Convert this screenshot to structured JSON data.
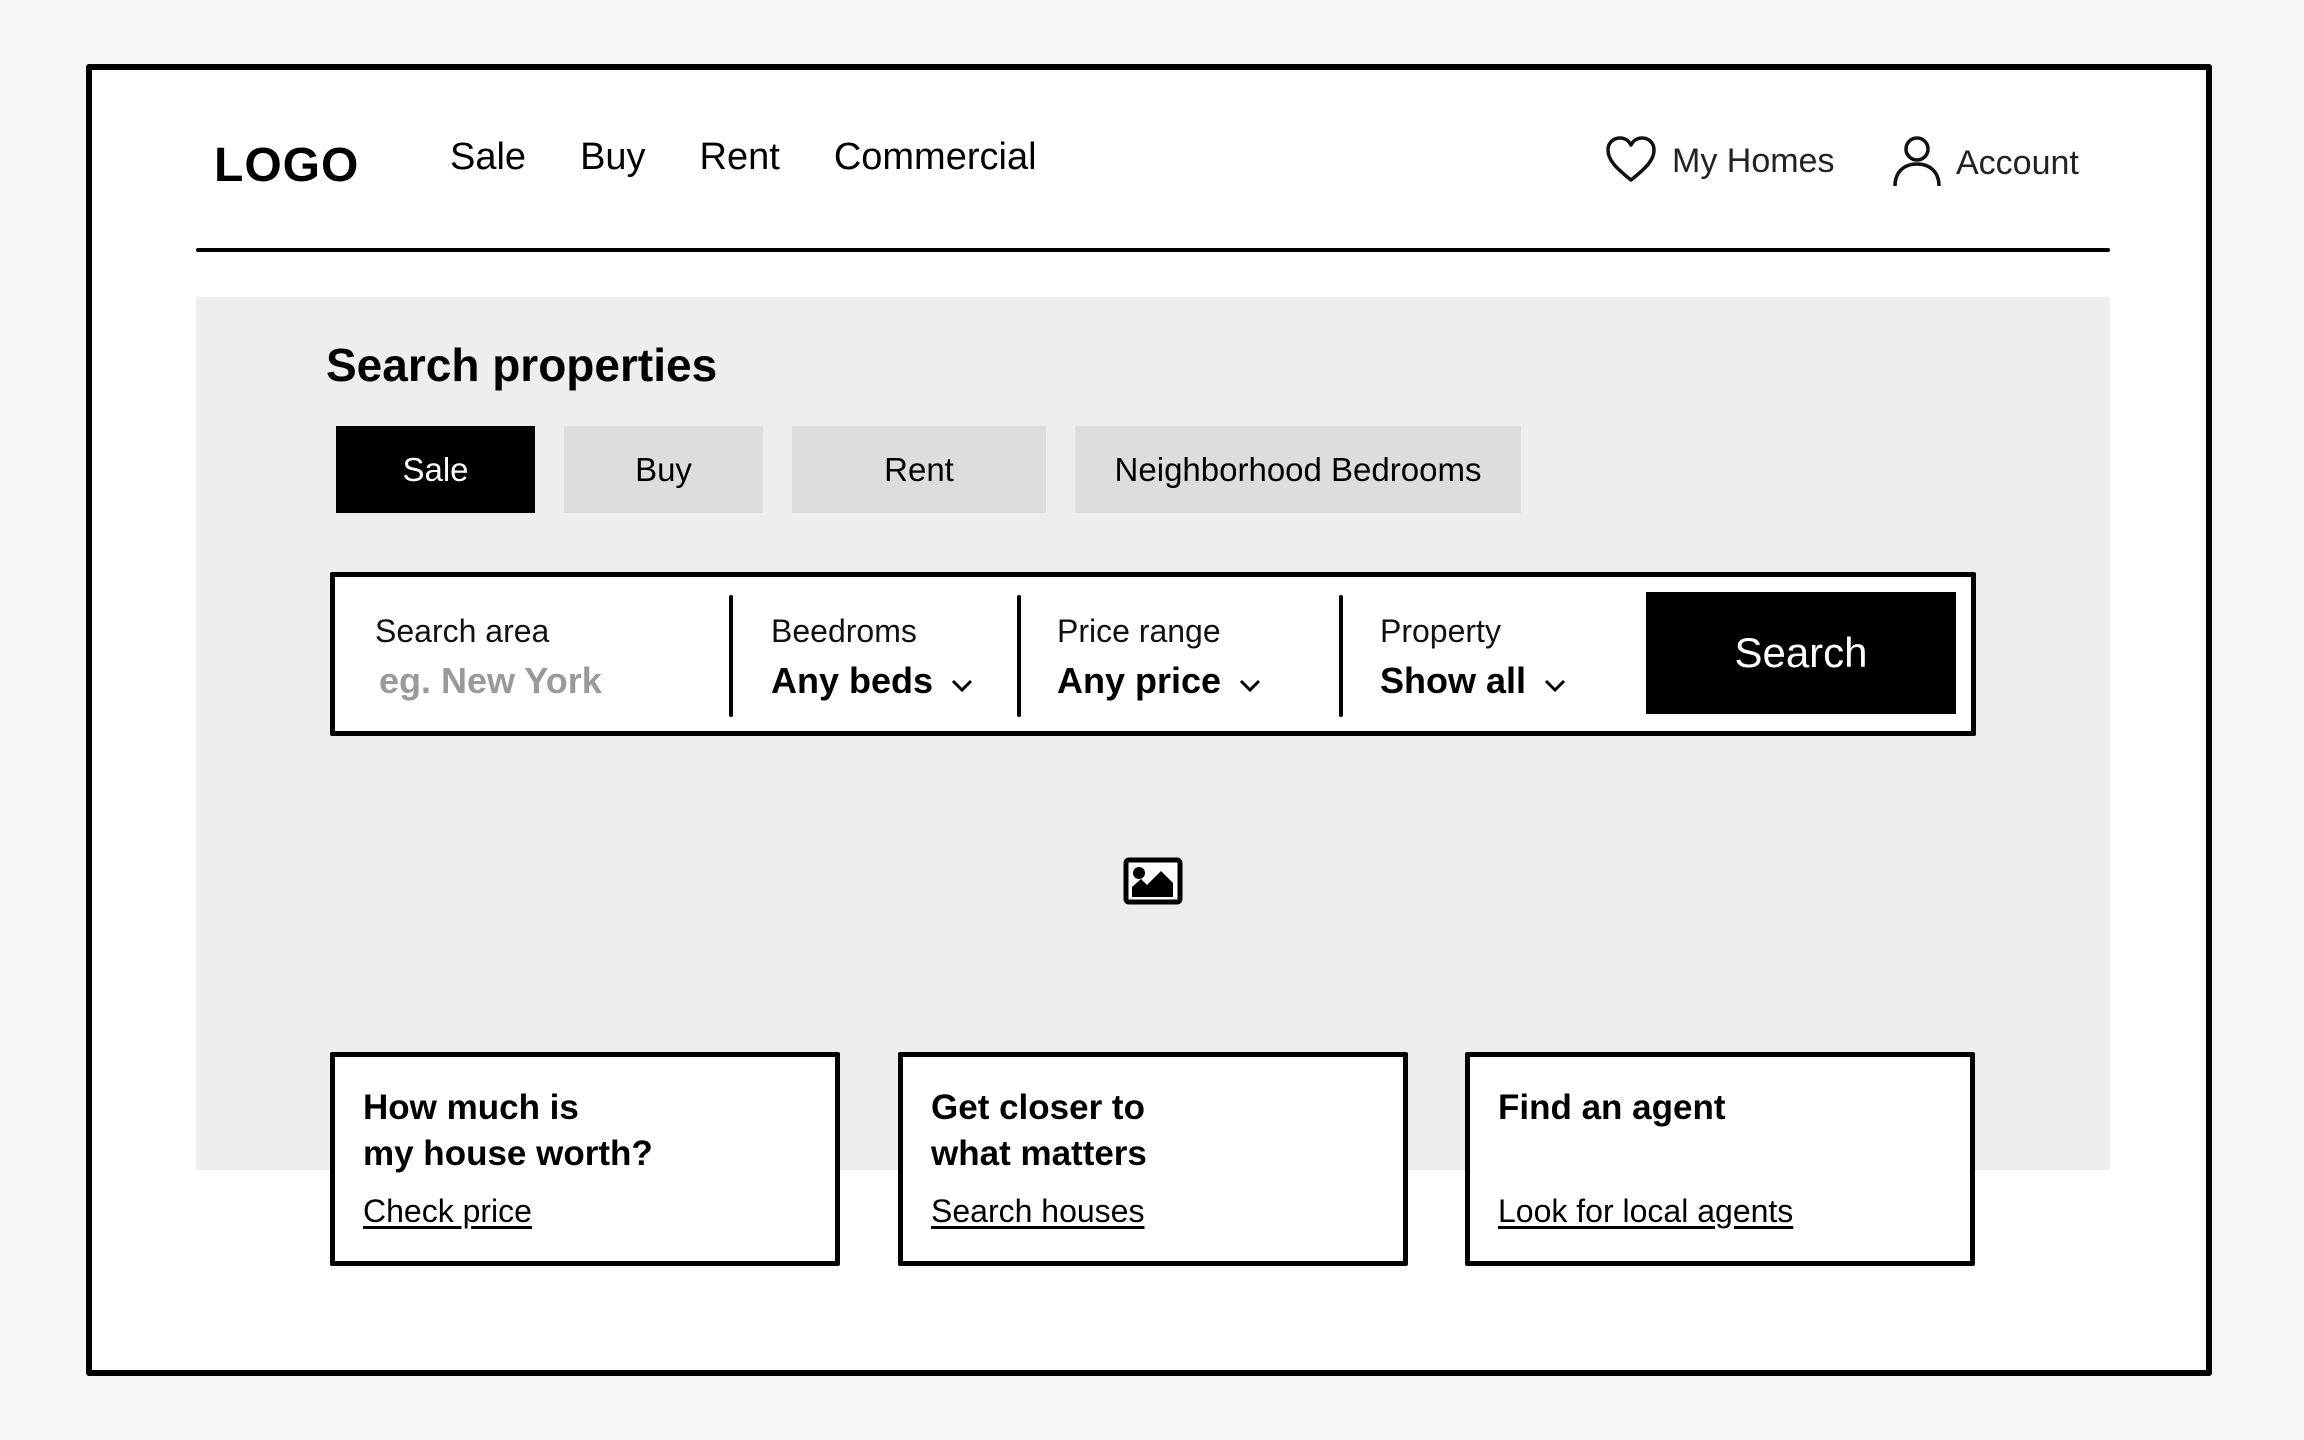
{
  "header": {
    "logo": "LOGO",
    "nav": [
      {
        "label": "Sale"
      },
      {
        "label": "Buy"
      },
      {
        "label": "Rent"
      },
      {
        "label": "Commercial"
      }
    ],
    "my_homes": {
      "label": "My Homes",
      "icon": "heart-icon"
    },
    "account": {
      "label": "Account",
      "icon": "user-icon"
    }
  },
  "hero": {
    "title": "Search properties",
    "tabs": [
      {
        "label": "Sale",
        "active": true
      },
      {
        "label": "Buy",
        "active": false
      },
      {
        "label": "Rent",
        "active": false
      },
      {
        "label": "Neighborhood Bedrooms",
        "active": false
      }
    ],
    "search": {
      "area": {
        "label": "Search area",
        "placeholder": "eg. New York",
        "value": ""
      },
      "bedrooms": {
        "label": "Beedroms",
        "value": "Any beds"
      },
      "price": {
        "label": "Price range",
        "value": "Any price"
      },
      "property": {
        "label": "Property",
        "value": "Show all"
      },
      "button_label": "Search"
    },
    "image_placeholder_icon": "image-icon"
  },
  "cards": [
    {
      "title": "How much is\nmy house worth?",
      "link": "Check price"
    },
    {
      "title": "Get closer to\nwhat matters",
      "link": "Search houses"
    },
    {
      "title": "Find an agent",
      "link": "Look for local agents"
    }
  ],
  "colors": {
    "page_bg": "#f5f5f5",
    "hero_bg": "#eeeeee",
    "tab_bg": "#dddddd",
    "accent": "#000000",
    "placeholder": "#9a9a9a"
  }
}
